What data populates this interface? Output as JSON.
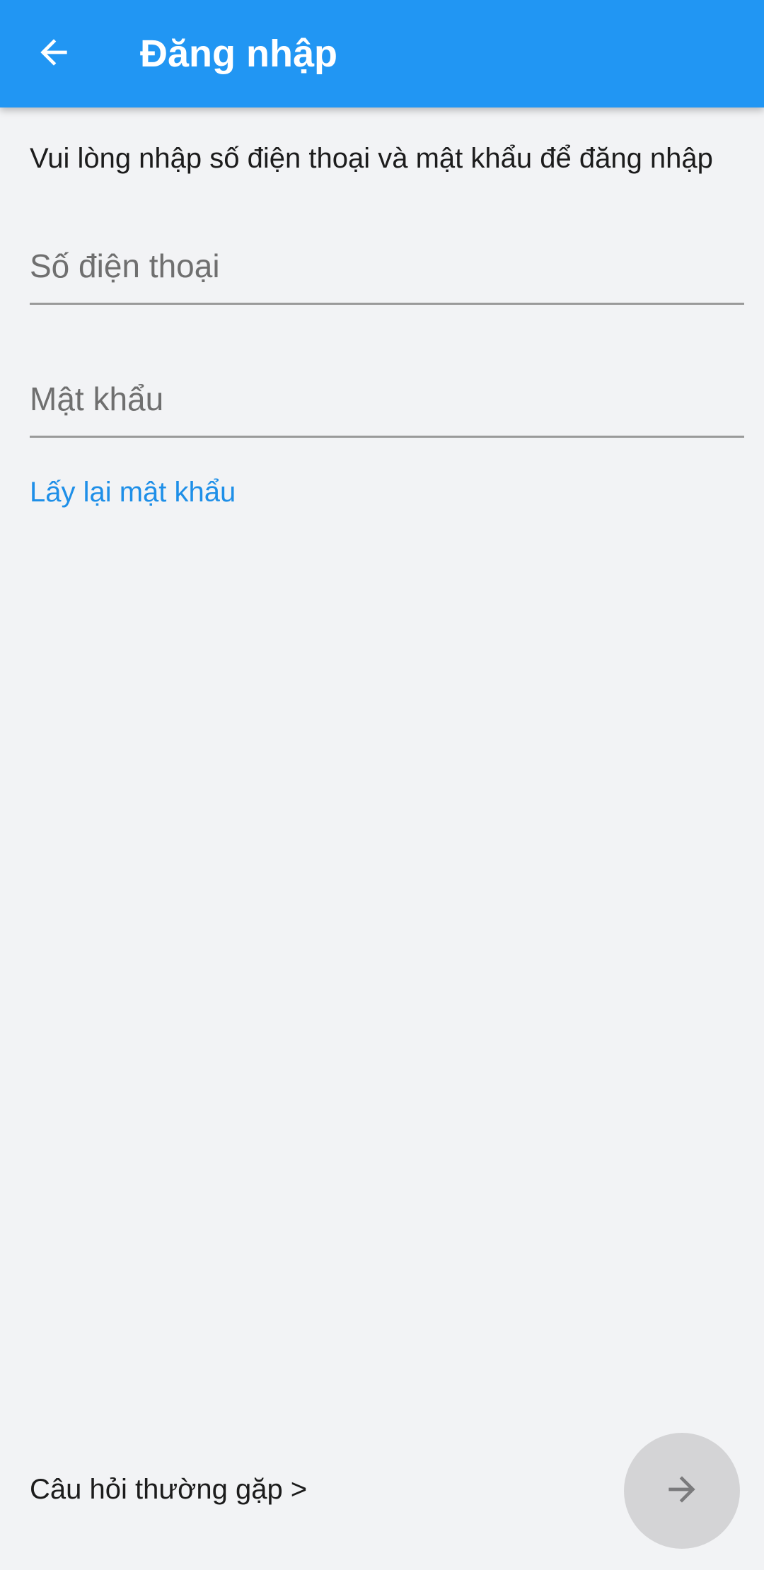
{
  "app_bar": {
    "title": "Đăng nhập",
    "back_icon": "arrow-left-icon",
    "color": "#2196f3"
  },
  "form": {
    "instruction": "Vui lòng nhập số điện thoại và mật khẩu để đăng nhập",
    "phone": {
      "placeholder": "Số điện thoại",
      "value": ""
    },
    "password": {
      "placeholder": "Mật khẩu",
      "value": ""
    },
    "forgot_password_label": "Lấy lại mật khẩu"
  },
  "footer": {
    "faq_label": "Câu hỏi thường gặp >",
    "next_icon": "arrow-right-icon",
    "next_enabled": false
  },
  "colors": {
    "background": "#f2f3f5",
    "link": "#1e8fe8",
    "fab_disabled": "#d4d4d6"
  }
}
